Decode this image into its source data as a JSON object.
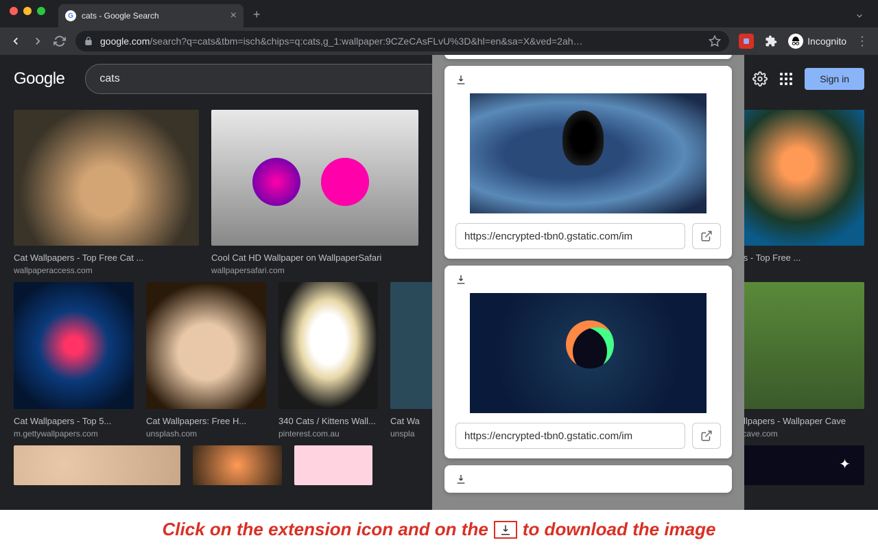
{
  "window": {
    "tab_title": "cats - Google Search",
    "url_domain": "google.com",
    "url_path": "/search?q=cats&tbm=isch&chips=q:cats,g_1:wallpaper:9CZeCAsFLvU%3D&hl=en&sa=X&ved=2ah…",
    "incognito_label": "Incognito"
  },
  "header": {
    "logo": "Google",
    "search_value": "cats",
    "signin_label": "Sign in"
  },
  "results": {
    "row1": [
      {
        "title": "Cat Wallpapers - Top Free Cat ...",
        "source": "wallpaperaccess.com"
      },
      {
        "title": "Cool Cat HD Wallpaper on WallpaperSafari",
        "source": "wallpapersafari.com"
      },
      {
        "title": "pers - Top Free ...",
        "source": ""
      }
    ],
    "row2": [
      {
        "title": "Cat Wallpapers - Top 5...",
        "source": "m.gettywallpapers.com"
      },
      {
        "title": "Cat Wallpapers: Free H...",
        "source": "unsplash.com"
      },
      {
        "title": "340 Cats / Kittens Wall...",
        "source": "pinterest.com.au"
      },
      {
        "title": "Cat Wa",
        "source": "unspla"
      },
      {
        "title": "Wallpapers - Wallpaper Cave",
        "source": "percave.com"
      }
    ]
  },
  "popup": {
    "url1": "https://encrypted-tbn0.gstatic.com/im",
    "url2": "https://encrypted-tbn0.gstatic.com/im"
  },
  "banner": {
    "text_before": "Click on the extension icon and on the",
    "text_after": "to download the image"
  }
}
